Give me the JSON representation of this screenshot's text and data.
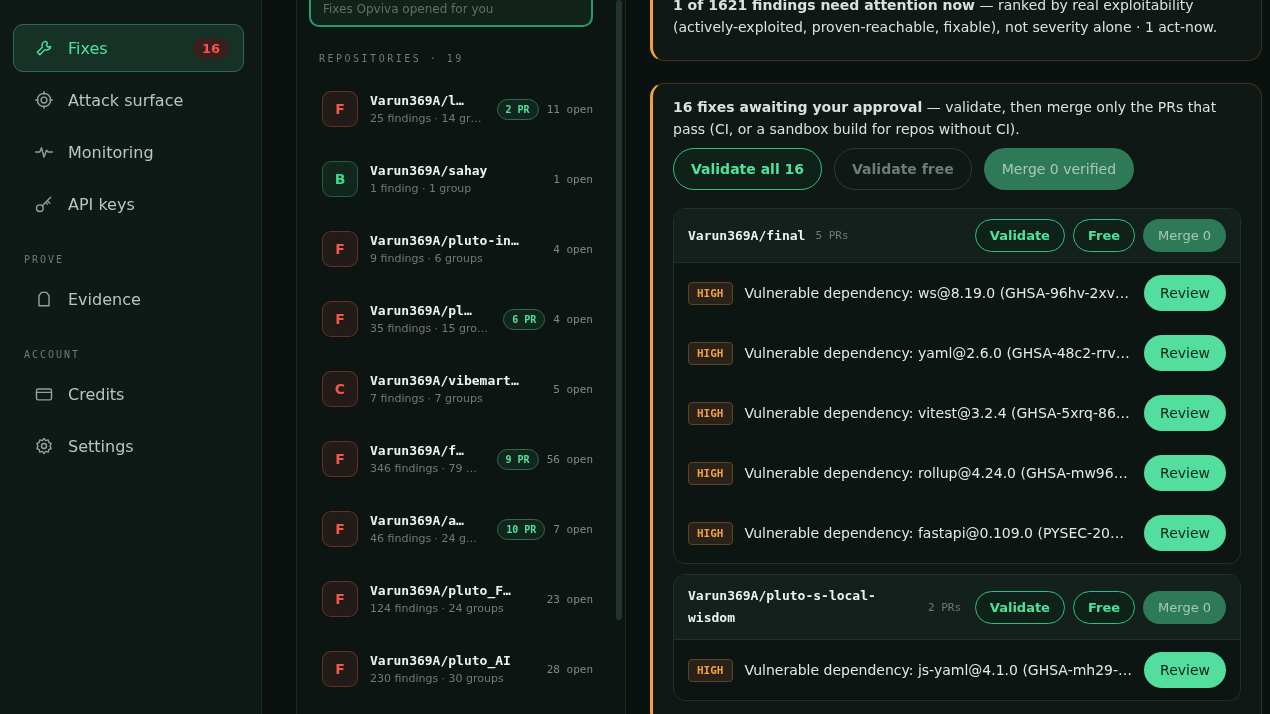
{
  "sidebar": {
    "items": [
      {
        "label": "Fixes",
        "badge": "16",
        "selected": true
      },
      {
        "label": "Attack surface",
        "selected": false
      },
      {
        "label": "Monitoring",
        "selected": false
      },
      {
        "label": "API keys",
        "selected": false
      },
      {
        "section": "PROVE"
      },
      {
        "label": "Evidence",
        "selected": false
      },
      {
        "section": "ACCOUNT"
      },
      {
        "label": "Credits",
        "selected": false
      },
      {
        "label": "Settings",
        "selected": false
      }
    ]
  },
  "repos": {
    "notice": "Fixes Opviva opened for you",
    "heading": "REPOSITORIES · 19",
    "items": [
      {
        "grade": "F",
        "color": "#f0594a",
        "name": "Varun369A/l…",
        "meta": "25 findings · 14 gr…",
        "pr": "2 PR",
        "open": "11 open"
      },
      {
        "grade": "B",
        "color": "#3fd68b",
        "name": "Varun369A/sahay",
        "meta": "1 finding · 1 group",
        "open": "1 open"
      },
      {
        "grade": "F",
        "color": "#f0594a",
        "name": "Varun369A/pluto-in…",
        "meta": "9 findings · 6 groups",
        "open": "4 open"
      },
      {
        "grade": "F",
        "color": "#f0594a",
        "name": "Varun369A/pl…",
        "meta": "35 findings · 15 gro…",
        "pr": "6 PR",
        "open": "4 open"
      },
      {
        "grade": "C",
        "color": "#f0594a",
        "name": "Varun369A/vibemart…",
        "meta": "7 findings · 7 groups",
        "open": "5 open"
      },
      {
        "grade": "F",
        "color": "#f0594a",
        "name": "Varun369A/f…",
        "meta": "346 findings · 79 …",
        "pr": "9 PR",
        "open": "56 open"
      },
      {
        "grade": "F",
        "color": "#f0594a",
        "name": "Varun369A/a…",
        "meta": "46 findings · 24 g…",
        "pr": "10 PR",
        "open": "7 open"
      },
      {
        "grade": "F",
        "color": "#f0594a",
        "name": "Varun369A/pluto_F…",
        "meta": "124 findings · 24 groups",
        "open": "23 open"
      },
      {
        "grade": "F",
        "color": "#f0594a",
        "name": "Varun369A/pluto_AI",
        "meta": "230 findings · 30 groups",
        "open": "28 open"
      }
    ]
  },
  "attention": {
    "text": "**1 of 1621 findings need attention now** — ranked by real exploitability (actively-exploited, proven-reachable, fixable), not severity alone · 1 act-now."
  },
  "approval": {
    "text": "**16 fixes awaiting your approval** — validate, then merge only the PRs that pass (CI, or a sandbox build for repos without CI).",
    "buttons": [
      {
        "label": "Validate all 16",
        "kind": "outline"
      },
      {
        "label": "Validate free",
        "kind": "muted"
      },
      {
        "label": "Merge 0 verified",
        "kind": "filled"
      }
    ],
    "groups": [
      {
        "repo": "Varun369A/final",
        "count": "5 PRs",
        "buttons": [
          {
            "label": "Validate",
            "kind": "outline"
          },
          {
            "label": "Free",
            "kind": "outline"
          },
          {
            "label": "Merge 0",
            "kind": "filled"
          }
        ],
        "findings": [
          {
            "severity": "HIGH",
            "title": "Vulnerable dependency: ws@8.19.0 (GHSA-96hv-2xv…",
            "action": "Review"
          },
          {
            "severity": "HIGH",
            "title": "Vulnerable dependency: yaml@2.6.0 (GHSA-48c2-rrv…",
            "action": "Review"
          },
          {
            "severity": "HIGH",
            "title": "Vulnerable dependency: vitest@3.2.4 (GHSA-5xrq-86…",
            "action": "Review"
          },
          {
            "severity": "HIGH",
            "title": "Vulnerable dependency: rollup@4.24.0 (GHSA-mw96…",
            "action": "Review"
          },
          {
            "severity": "HIGH",
            "title": "Vulnerable dependency: fastapi@0.109.0 (PYSEC-20…",
            "action": "Review"
          }
        ]
      },
      {
        "repo": "Varun369A/pluto-s-local-wisdom",
        "count": "2 PRs",
        "buttons": [
          {
            "label": "Validate",
            "kind": "outline"
          },
          {
            "label": "Free",
            "kind": "outline"
          },
          {
            "label": "Merge 0",
            "kind": "filled"
          }
        ],
        "findings": [
          {
            "severity": "HIGH",
            "title": "Vulnerable dependency: js-yaml@4.1.0 (GHSA-mh29-…",
            "action": "Review"
          }
        ]
      }
    ]
  }
}
